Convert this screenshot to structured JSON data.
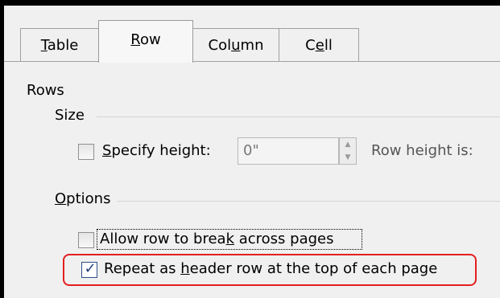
{
  "tabs": [
    {
      "label_prefix": "",
      "label_accel": "T",
      "label_suffix": "able"
    },
    {
      "label_prefix": "",
      "label_accel": "R",
      "label_suffix": "ow"
    },
    {
      "label_prefix": "Col",
      "label_accel": "u",
      "label_suffix": "mn"
    },
    {
      "label_prefix": "C",
      "label_accel": "e",
      "label_suffix": "ll"
    }
  ],
  "selected_tab": "Row",
  "rows_heading": "Rows",
  "size_group": "Size",
  "specify_height": {
    "prefix": "",
    "accel": "S",
    "suffix": "pecify height:",
    "checked": false
  },
  "height_value": "0\"",
  "row_height_is": "Row height is:",
  "options_group": {
    "prefix": "",
    "accel": "O",
    "suffix": "ptions"
  },
  "allow_break": {
    "prefix": "Allow row to brea",
    "accel": "k",
    "suffix": " across pages",
    "checked": false
  },
  "repeat_header": {
    "prefix": "Repeat as ",
    "accel": "h",
    "suffix": "eader row at the top of each page",
    "checked": true
  },
  "colors": {
    "highlight": "#e41e1e",
    "check": "#1c3f7b"
  }
}
